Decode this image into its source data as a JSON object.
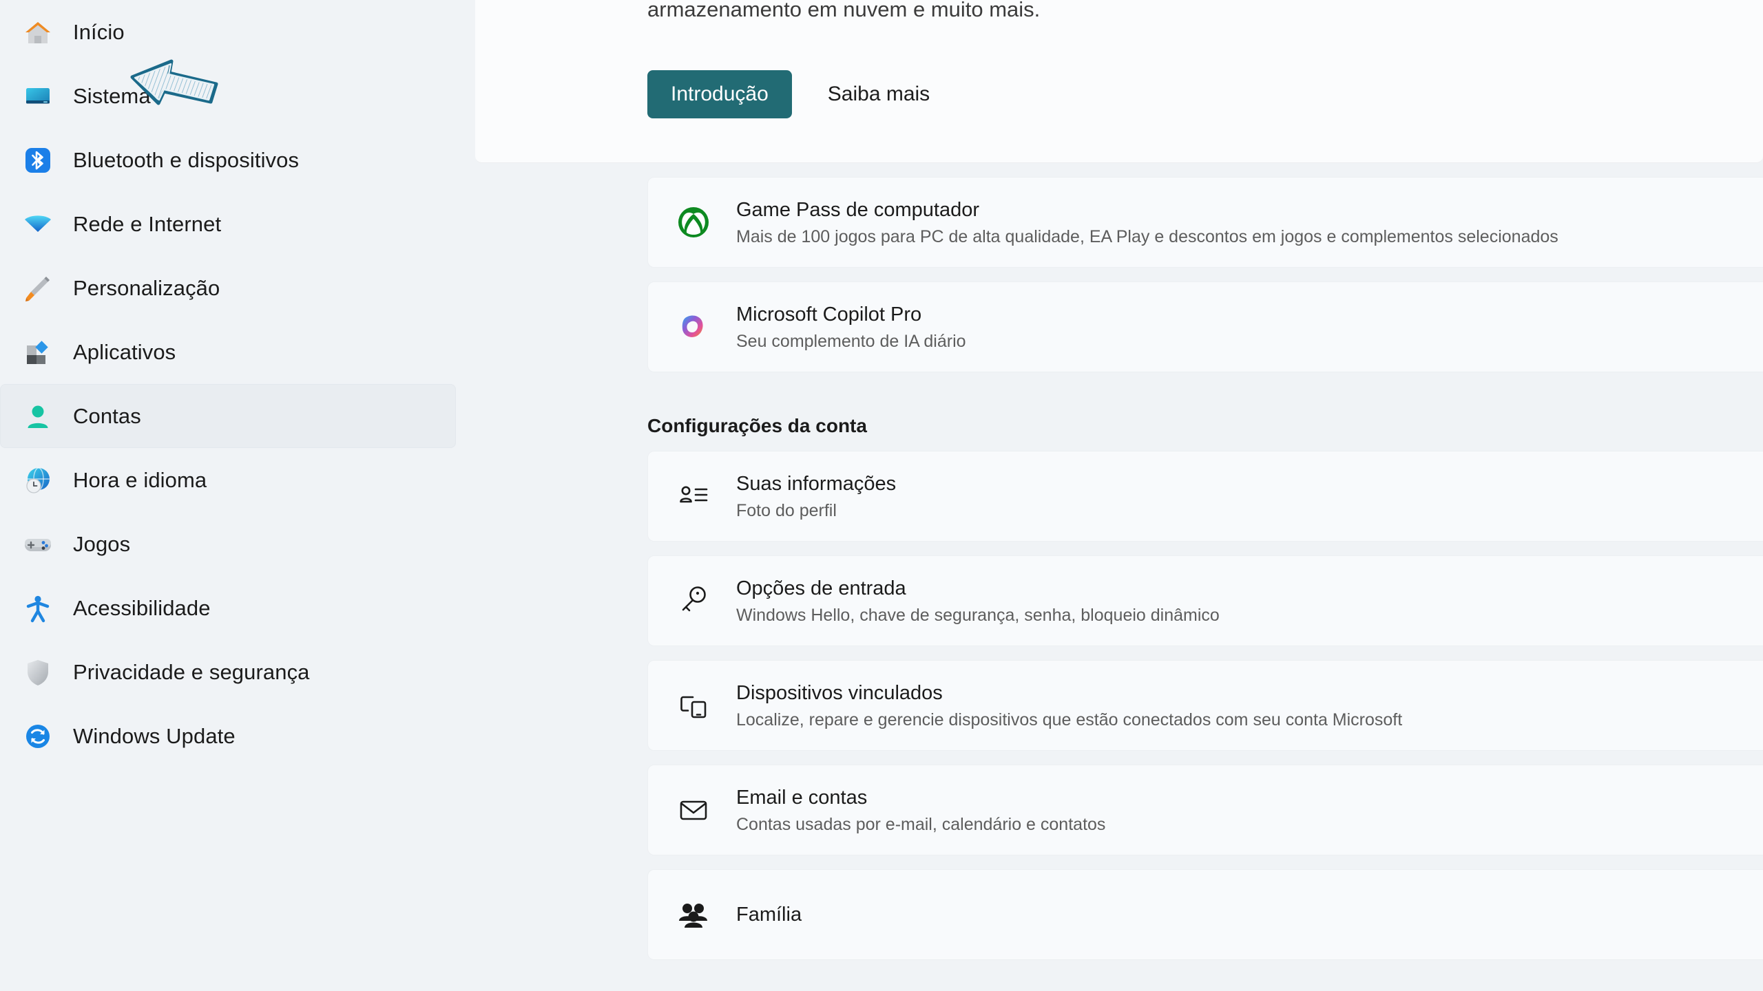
{
  "sidebar": {
    "items": [
      {
        "label": "Início",
        "icon": "home-icon",
        "selected": false
      },
      {
        "label": "Sistema",
        "icon": "system-monitor-icon",
        "selected": false
      },
      {
        "label": "Bluetooth e dispositivos",
        "icon": "bluetooth-icon",
        "selected": false
      },
      {
        "label": "Rede e Internet",
        "icon": "wifi-icon",
        "selected": false
      },
      {
        "label": "Personalização",
        "icon": "paintbrush-icon",
        "selected": false
      },
      {
        "label": "Aplicativos",
        "icon": "apps-icon",
        "selected": false
      },
      {
        "label": "Contas",
        "icon": "person-icon",
        "selected": true
      },
      {
        "label": "Hora e idioma",
        "icon": "clock-globe-icon",
        "selected": false
      },
      {
        "label": "Jogos",
        "icon": "gamepad-icon",
        "selected": false
      },
      {
        "label": "Acessibilidade",
        "icon": "accessibility-icon",
        "selected": false
      },
      {
        "label": "Privacidade e segurança",
        "icon": "shield-icon",
        "selected": false
      },
      {
        "label": "Windows Update",
        "icon": "update-refresh-icon",
        "selected": false
      }
    ]
  },
  "hero": {
    "description_tail": "armazenamento em nuvem e muito mais.",
    "primary_button": "Introdução",
    "secondary_link": "Saiba mais"
  },
  "promo_cards": [
    {
      "title": "Game Pass de computador",
      "subtitle": "Mais de 100 jogos para PC de alta qualidade, EA Play e descontos em jogos e complementos selecionados",
      "icon": "xbox-icon"
    },
    {
      "title": "Microsoft Copilot Pro",
      "subtitle": "Seu complemento de IA diário",
      "icon": "copilot-icon"
    }
  ],
  "account_section": {
    "heading": "Configurações da conta",
    "rows": [
      {
        "title": "Suas informações",
        "subtitle": "Foto do perfil",
        "icon": "contact-info-icon"
      },
      {
        "title": "Opções de entrada",
        "subtitle": "Windows Hello, chave de segurança, senha, bloqueio dinâmico",
        "icon": "key-icon"
      },
      {
        "title": "Dispositivos vinculados",
        "subtitle": "Localize, repare e gerencie dispositivos que estão conectados com seu conta Microsoft",
        "icon": "linked-devices-icon"
      },
      {
        "title": "Email e contas",
        "subtitle": "Contas usadas por e-mail, calendário e contatos",
        "icon": "envelope-icon"
      },
      {
        "title": "Família",
        "subtitle": "",
        "icon": "family-icon"
      }
    ]
  },
  "annotation": {
    "type": "hand-drawn-cursor-arrow",
    "color": "#1b6a8a"
  },
  "colors": {
    "page_background": "#f0f3f6",
    "card_background": "#f8fafc",
    "accent_teal": "#226b74",
    "selection_bar": "#18646e",
    "selected_row": "#e9edf1",
    "title_text": "#1b1b1b",
    "subtitle_text": "#5d5d5d"
  }
}
